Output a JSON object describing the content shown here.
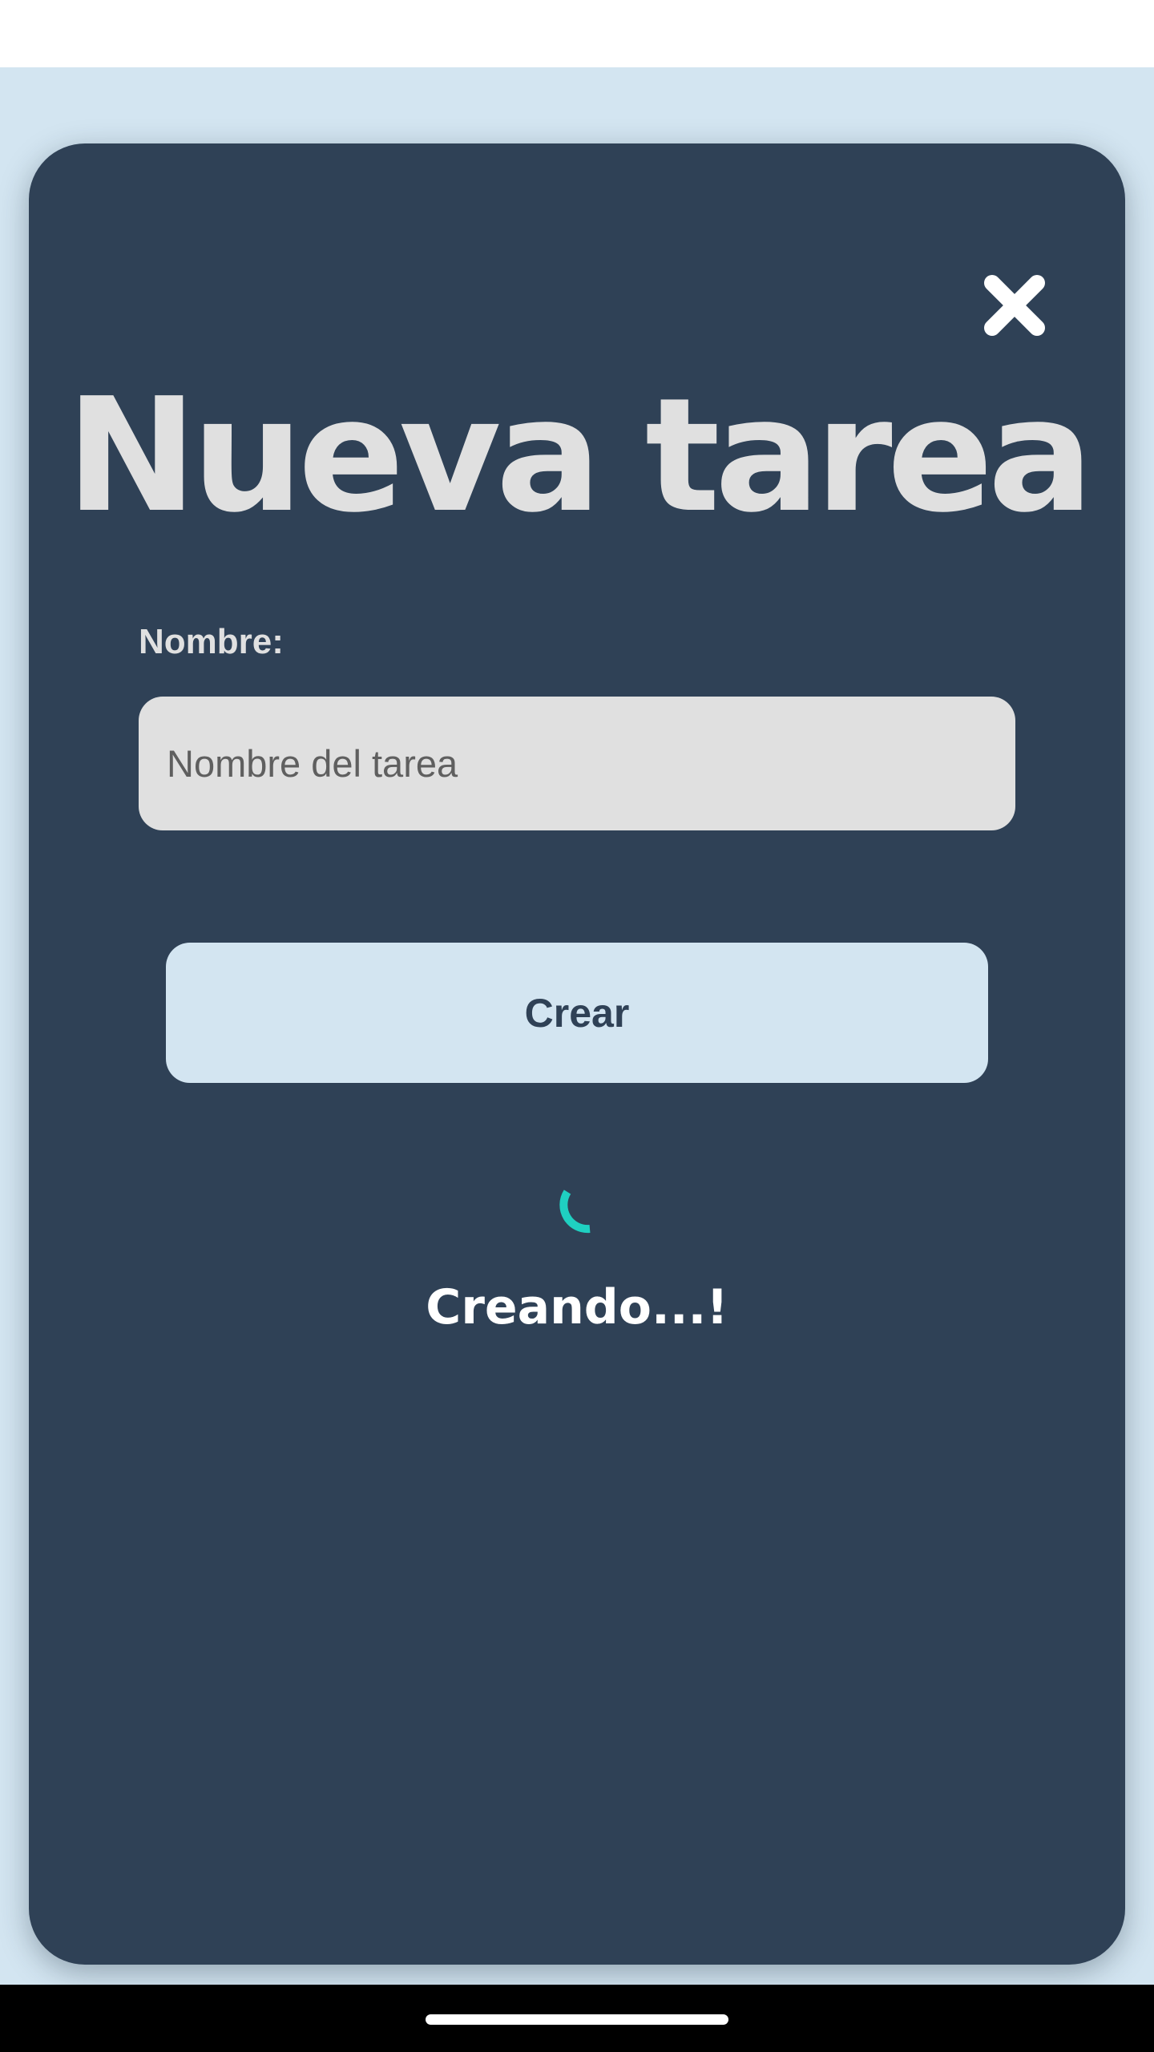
{
  "modal": {
    "title": "Nueva tarea",
    "close_icon": "close-icon",
    "name_label": "Nombre:",
    "name_input": {
      "value": "",
      "placeholder": "Nombre del tarea"
    },
    "create_button_label": "Crear",
    "loading_icon": "spinner-icon",
    "status_text": "Creando...!"
  },
  "colors": {
    "modal_background": "#2f4156",
    "page_background": "#d3e5f1",
    "input_background": "#e0e0e0",
    "title_text": "#e0e0e0",
    "button_background": "#d3e5f1",
    "button_text": "#2f4156",
    "spinner_accent": "#1fd0c1",
    "nav_bar": "#000000"
  }
}
